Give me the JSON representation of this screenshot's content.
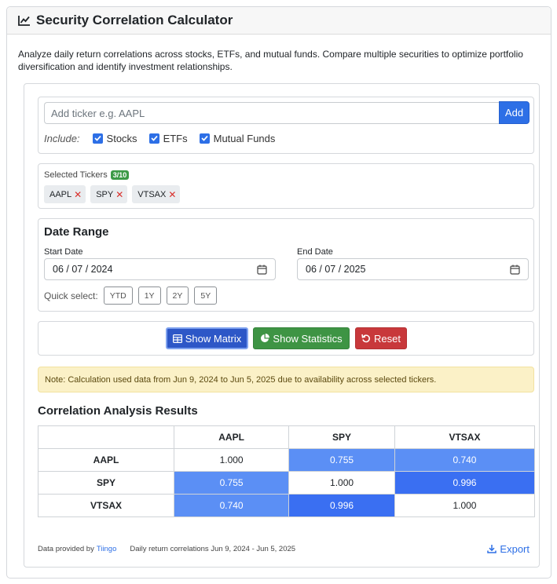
{
  "header": {
    "title": "Security Correlation Calculator"
  },
  "intro": "Analyze daily return correlations across stocks, ETFs, and mutual funds. Compare multiple securities to optimize portfolio diversification and identify investment relationships.",
  "ticker": {
    "placeholder": "Add ticker e.g. AAPL",
    "add_label": "Add",
    "include_label": "Include:",
    "options": [
      "Stocks",
      "ETFs",
      "Mutual Funds"
    ]
  },
  "selected": {
    "title": "Selected Tickers",
    "count": "3/10",
    "tickers": [
      "AAPL",
      "SPY",
      "VTSAX"
    ]
  },
  "date_range": {
    "title": "Date Range",
    "start_label": "Start Date",
    "start_value": "06 / 07 / 2024",
    "end_label": "End Date",
    "end_value": "06 / 07 / 2025",
    "quick_label": "Quick select:",
    "quick": [
      "YTD",
      "1Y",
      "2Y",
      "5Y"
    ]
  },
  "actions": {
    "matrix": "Show Matrix",
    "stats": "Show Statistics",
    "reset": "Reset"
  },
  "note": "Note: Calculation used data from Jun 9, 2024 to Jun 5, 2025 due to availability across selected tickers.",
  "results": {
    "title": "Correlation Analysis Results",
    "columns": [
      "AAPL",
      "SPY",
      "VTSAX"
    ],
    "rows": [
      {
        "label": "AAPL",
        "values": [
          "1.000",
          "0.755",
          "0.740"
        ]
      },
      {
        "label": "SPY",
        "values": [
          "0.755",
          "1.000",
          "0.996"
        ]
      },
      {
        "label": "VTSAX",
        "values": [
          "0.740",
          "0.996",
          "1.000"
        ]
      }
    ]
  },
  "footer": {
    "provided_by": "Data provided by",
    "provider": "Tiingo",
    "range_text": "Daily return correlations Jun 9, 2024 - Jun 5, 2025",
    "export": "Export"
  },
  "colors": {
    "primary": "#2d6fe6",
    "success": "#3e9444",
    "danger": "#c8383b",
    "corr_strong": "#3a6ff2",
    "corr_mid": "#5b8ff5"
  }
}
